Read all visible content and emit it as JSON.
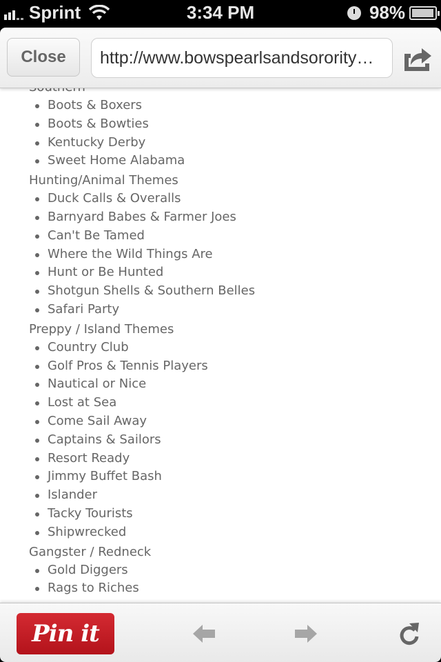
{
  "status_bar": {
    "carrier": "Sprint",
    "time": "3:34 PM",
    "battery_percent": "98%",
    "battery_level": 0.98,
    "icons": [
      "signal-icon",
      "wifi-icon",
      "clock-icon",
      "battery-icon"
    ]
  },
  "toolbar": {
    "close_label": "Close",
    "url": "http://www.bowspearlsandsorority…",
    "share_icon": "share-icon"
  },
  "content": {
    "partial_heading": "Southern",
    "sections": [
      {
        "title": "Southern",
        "items": [
          "Boots & Boxers",
          "Boots & Bowties",
          "Kentucky Derby",
          "Sweet Home Alabama"
        ]
      },
      {
        "title": "Hunting/Animal Themes",
        "items": [
          "Duck Calls & Overalls",
          "Barnyard Babes & Farmer Joes",
          "Can't Be Tamed",
          "Where the Wild Things Are",
          "Hunt or Be Hunted",
          "Shotgun Shells & Southern Belles",
          "Safari Party"
        ]
      },
      {
        "title": "Preppy / Island Themes",
        "items": [
          "Country Club",
          "Golf Pros & Tennis Players",
          "Nautical or Nice",
          "Lost at Sea",
          "Come Sail Away",
          "Captains & Sailors",
          "Resort Ready",
          "Jimmy Buffet Bash",
          "Islander",
          "Tacky Tourists",
          "Shipwrecked"
        ]
      },
      {
        "title": "Gangster / Redneck",
        "items": [
          "Gold Diggers",
          "Rags to Riches"
        ]
      }
    ]
  },
  "bottom_bar": {
    "pin_label": "Pin it",
    "pin_color": "#c41e26",
    "back_icon": "back-arrow-icon",
    "forward_icon": "forward-arrow-icon",
    "reload_icon": "reload-icon"
  }
}
